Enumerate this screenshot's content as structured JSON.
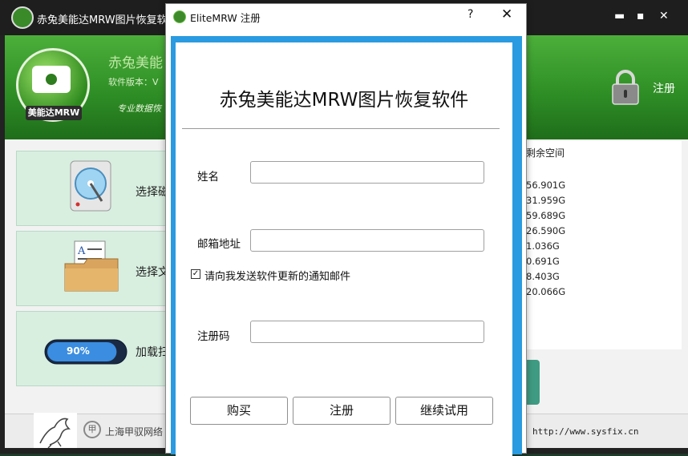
{
  "app": {
    "title": "赤兔美能达MRW图片恢复软件",
    "logo_label": "美能达MRW",
    "header_name": "赤兔美能",
    "header_version": "软件版本：V",
    "header_slogan": "专业数据恢",
    "register_link": "注册",
    "window_controls": {
      "minimize": "▬",
      "maximize": "▪",
      "close": "✕"
    }
  },
  "options": [
    {
      "label": "选择磁",
      "icon": "disk-icon"
    },
    {
      "label": "选择文",
      "icon": "folder-icon"
    },
    {
      "label": "加载扫",
      "icon": "progress-icon",
      "progress_text": "90%",
      "progress": 0.9
    }
  ],
  "disk_list": {
    "header": "剩余空间",
    "values": [
      "56.901G",
      "31.959G",
      "59.689G",
      "26.590G",
      "1.036G",
      "0.691G",
      "8.403G",
      "20.066G"
    ]
  },
  "footer": {
    "company": "上海甲驭网络",
    "company_icon": "甲",
    "url": "http://www.sysfix.cn"
  },
  "dialog": {
    "title": "EliteMRW 注册",
    "help": "?",
    "close": "✕",
    "heading": "赤兔美能达MRW图片恢复软件",
    "fields": {
      "name_label": "姓名",
      "name_value": "",
      "email_label": "邮箱地址",
      "email_value": "",
      "code_label": "注册码",
      "code_value": ""
    },
    "checkbox": {
      "checked": true,
      "mark": "✓",
      "label": "请向我发送软件更新的通知邮件"
    },
    "buttons": {
      "buy": "购买",
      "register": "注册",
      "continue_trial": "继续试用"
    }
  },
  "colors": {
    "header_green": "#3a9a2e",
    "dialog_frame_blue": "#2a9be0",
    "option_bg": "#d8efe0"
  }
}
